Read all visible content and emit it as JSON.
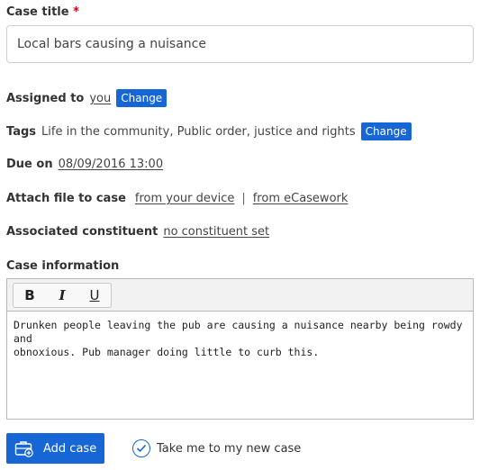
{
  "case_title": {
    "label": "Case title",
    "required_mark": "*",
    "value": "Local bars causing a nuisance"
  },
  "assigned": {
    "label": "Assigned to",
    "value": "you",
    "change_label": "Change"
  },
  "tags": {
    "label": "Tags",
    "value": "Life in the community, Public order, justice and rights",
    "change_label": "Change"
  },
  "due": {
    "label": "Due on",
    "value": "08/09/2016 13:00"
  },
  "attach": {
    "label": "Attach file to case",
    "option1": "from your device",
    "separator": "|",
    "option2": "from eCasework"
  },
  "constituent": {
    "label": "Associated constituent",
    "value": "no constituent set"
  },
  "case_info": {
    "label": "Case information",
    "toolbar": {
      "bold": "B",
      "italic": "I",
      "underline": "U"
    },
    "line1": "Drunken people leaving the pub are causing a nuisance nearby being rowdy and",
    "line2": "obnoxious. Pub manager doing little to curb this."
  },
  "actions": {
    "add_label": "Add case",
    "redirect_label": "Take me to my new case",
    "redirect_checked": true
  },
  "colors": {
    "accent": "#1766d6",
    "required": "#d0021b"
  }
}
